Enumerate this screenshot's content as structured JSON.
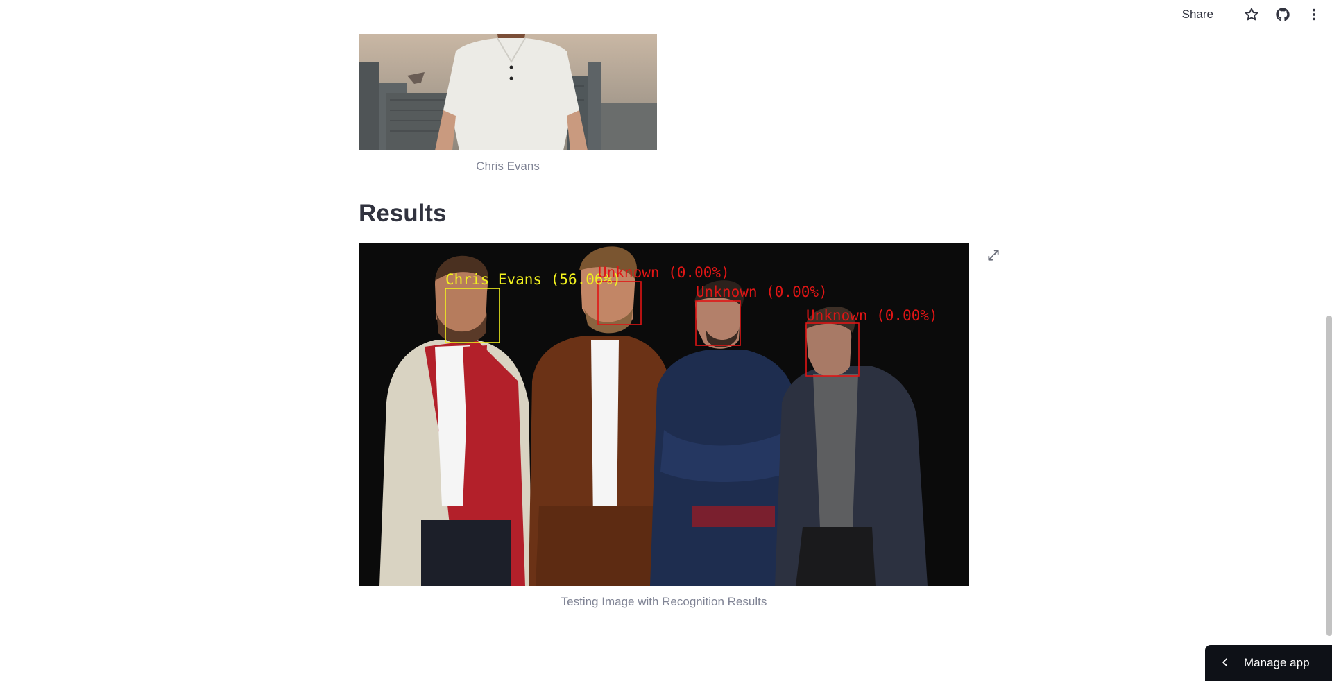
{
  "toolbar": {
    "share_label": "Share",
    "icons": [
      "star-icon",
      "github-icon",
      "more-vert-icon"
    ]
  },
  "top_image": {
    "caption": "Chris Evans"
  },
  "results": {
    "heading": "Results",
    "caption": "Testing Image with Recognition Results",
    "detections": [
      {
        "label": "Chris Evans (56.06%)",
        "color": "#f2f21e"
      },
      {
        "label": "Unknown (0.00%)",
        "color": "#e01515"
      },
      {
        "label": "Unknown (0.00%)",
        "color": "#e01515"
      },
      {
        "label": "Unknown (0.00%)",
        "color": "#e01515"
      }
    ]
  },
  "manage_app": {
    "label": "Manage app"
  },
  "colors": {
    "text": "#31333f",
    "caption": "#808495",
    "manage_bg": "#0e1117",
    "known_box": "#f2f21e",
    "unknown_box": "#e01515"
  }
}
